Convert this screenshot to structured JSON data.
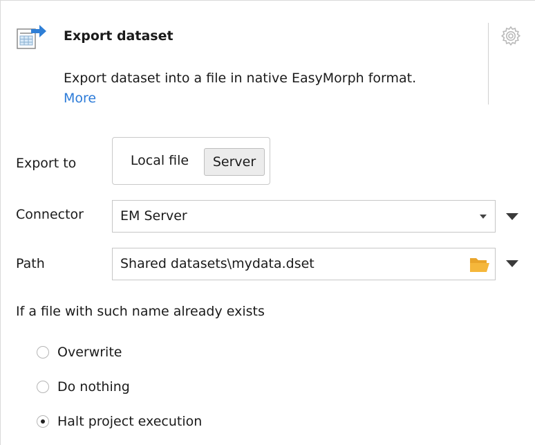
{
  "header": {
    "icon": "export-dataset-icon",
    "title": "Export dataset",
    "description": "Export dataset into a file in native EasyMorph format.",
    "more_link": "More",
    "settings_icon": "gear-icon"
  },
  "export_to": {
    "label": "Export to",
    "options": [
      "Local file",
      "Server"
    ],
    "selected": "Server"
  },
  "connector": {
    "label": "Connector",
    "value": "EM Server"
  },
  "path": {
    "label": "Path",
    "value": "Shared datasets\\mydata.dset",
    "browse_icon": "folder-icon"
  },
  "if_exists": {
    "label": "If a file with such name already exists",
    "options": [
      {
        "label": "Overwrite",
        "checked": false
      },
      {
        "label": "Do nothing",
        "checked": false
      },
      {
        "label": "Halt project execution",
        "checked": true
      }
    ]
  },
  "colors": {
    "link": "#2c7bd8",
    "folder": "#f5b73b",
    "selected_segment": "#ececec"
  }
}
